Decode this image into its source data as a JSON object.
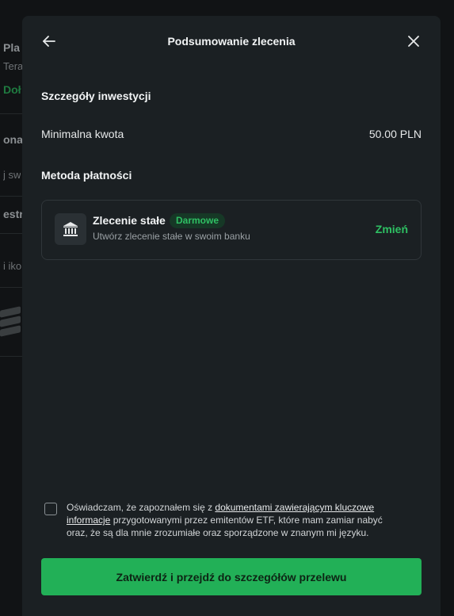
{
  "background": {
    "fragments": [
      "Pla",
      "Tera",
      "Doł",
      "onal",
      "j sw",
      "estr",
      "i iko"
    ]
  },
  "modal": {
    "title": "Podsumowanie zlecenia",
    "investment_details": {
      "heading": "Szczegóły inwestycji",
      "min_amount_label": "Minimalna kwota",
      "min_amount_value": "50.00 PLN"
    },
    "payment": {
      "heading": "Metoda płatności",
      "method_name": "Zlecenie stałe",
      "badge": "Darmowe",
      "description": "Utwórz zlecenie stałe w swoim banku",
      "change_label": "Zmień"
    },
    "consent": {
      "text_before": "Oświadczam, że zapoznałem się z ",
      "link_text": "dokumentami zawierającym kluczowe informacje",
      "text_after": " przygotowanymi przez emitentów ETF, które mam zamiar nabyć oraz, że są dla mnie zrozumiałe oraz sporządzone w znanym mi języku.",
      "checked": false
    },
    "confirm_label": "Zatwierdź i przejdź do szczegółów przelewu"
  },
  "colors": {
    "accent": "#22b057",
    "badge_text": "#2fbf63",
    "modal_bg": "#1b2023"
  }
}
